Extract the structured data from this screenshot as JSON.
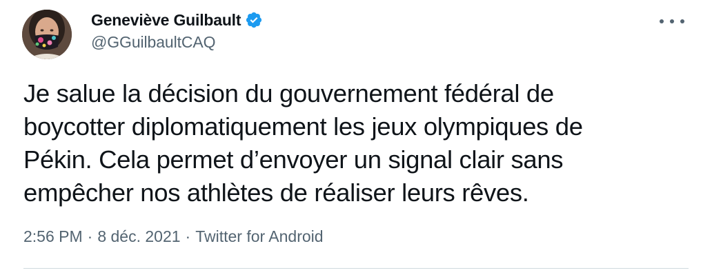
{
  "author": {
    "display_name": "Geneviève Guilbault",
    "handle": "@GGuilbaultCAQ",
    "verified": true,
    "avatar_icon": "profile-photo",
    "verified_icon": "verified-badge-icon"
  },
  "menu": {
    "icon": "more-horizontal-icon"
  },
  "tweet": {
    "text_lines": [
      "Je salue la décision du gouvernement fédéral de",
      "boycotter diplomatiquement les jeux olympiques de",
      "Pékin. Cela permet d’envoyer un signal clair sans",
      "empêcher nos athlètes de réaliser leurs rêves."
    ]
  },
  "meta": {
    "time": "2:56 PM",
    "separator": "·",
    "date": "8 déc. 2021",
    "source": "Twitter for Android"
  },
  "colors": {
    "text_primary": "#0f1419",
    "text_secondary": "#536471",
    "verified_blue": "#1d9bf0",
    "divider": "#cfd9de"
  }
}
